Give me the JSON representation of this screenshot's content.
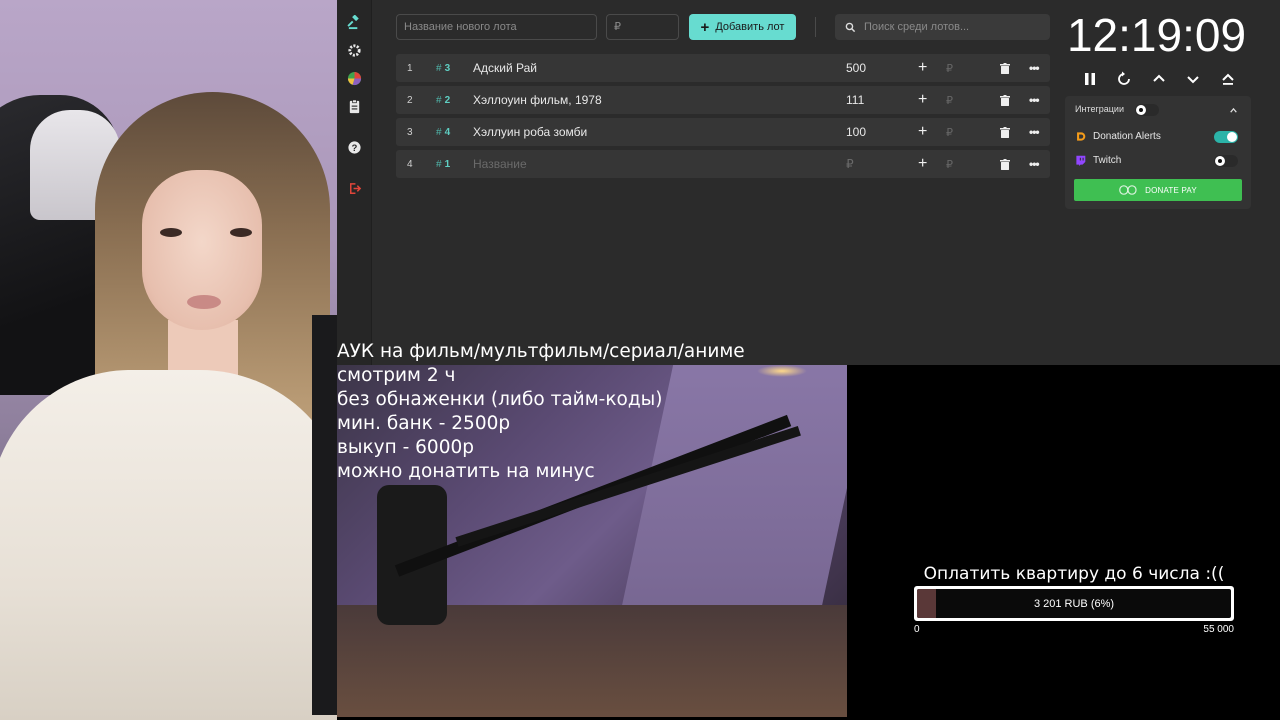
{
  "toolbar": {
    "new_lot_placeholder": "Название нового лота",
    "amount_placeholder": "₽",
    "add_button_label": "Добавить лот",
    "search_placeholder": "Поиск среди лотов..."
  },
  "lots": [
    {
      "num": "1",
      "id": "3",
      "name": "Адский Рай",
      "amount": "500",
      "currency": "₽"
    },
    {
      "num": "2",
      "id": "2",
      "name": "Хэллоуин фильм, 1978",
      "amount": "111",
      "currency": "₽"
    },
    {
      "num": "3",
      "id": "4",
      "name": "Хэллуин роба зомби",
      "amount": "100",
      "currency": "₽"
    },
    {
      "num": "4",
      "id": "1",
      "name": "Название",
      "amount": "₽",
      "currency": "₽"
    }
  ],
  "timer": {
    "value": "12:19:09"
  },
  "integrations": {
    "header": "Интеграции",
    "header_toggle": "off",
    "items": [
      {
        "name": "Donation Alerts",
        "icon": "donation-alerts-icon",
        "state": "on"
      },
      {
        "name": "Twitch",
        "icon": "twitch-icon",
        "state": "off"
      }
    ],
    "donate_pay_label": "DONATE PAY"
  },
  "overlay_rules": [
    "АУК на фильм/мультфильм/сериал/аниме",
    "смотрим 2 ч",
    "без обнаженки (либо тайм-коды)",
    "мин. банк - 2500р",
    "выкуп - 6000р",
    "можно донатить на минус"
  ],
  "goal": {
    "title": "Оплатить квартиру до 6 числа :((",
    "progress_text": "3 201 RUB (6%)",
    "progress_fraction": 0.06,
    "min_label": "0",
    "max_label": "55 000"
  },
  "colors": {
    "accent": "#67dcd0",
    "panel_bg": "#2b2b2b",
    "row_bg": "#363636",
    "donate_pay": "#3fbf52",
    "danger_logout": "#e0453a"
  }
}
